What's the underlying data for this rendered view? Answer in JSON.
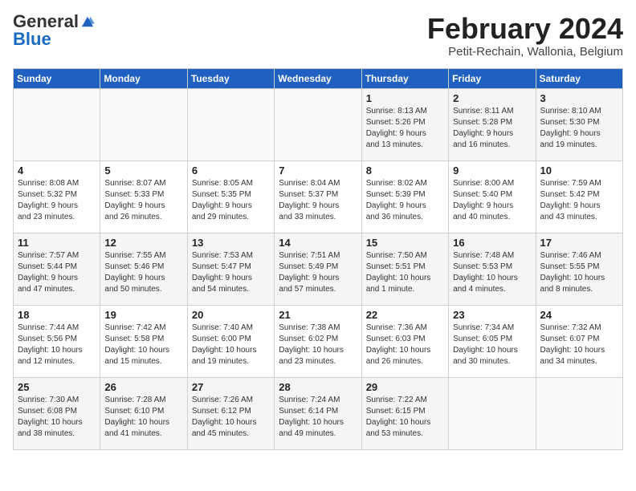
{
  "header": {
    "logo_general": "General",
    "logo_blue": "Blue",
    "month": "February 2024",
    "location": "Petit-Rechain, Wallonia, Belgium"
  },
  "days_of_week": [
    "Sunday",
    "Monday",
    "Tuesday",
    "Wednesday",
    "Thursday",
    "Friday",
    "Saturday"
  ],
  "weeks": [
    [
      {
        "day": "",
        "content": ""
      },
      {
        "day": "",
        "content": ""
      },
      {
        "day": "",
        "content": ""
      },
      {
        "day": "",
        "content": ""
      },
      {
        "day": "1",
        "content": "Sunrise: 8:13 AM\nSunset: 5:26 PM\nDaylight: 9 hours\nand 13 minutes."
      },
      {
        "day": "2",
        "content": "Sunrise: 8:11 AM\nSunset: 5:28 PM\nDaylight: 9 hours\nand 16 minutes."
      },
      {
        "day": "3",
        "content": "Sunrise: 8:10 AM\nSunset: 5:30 PM\nDaylight: 9 hours\nand 19 minutes."
      }
    ],
    [
      {
        "day": "4",
        "content": "Sunrise: 8:08 AM\nSunset: 5:32 PM\nDaylight: 9 hours\nand 23 minutes."
      },
      {
        "day": "5",
        "content": "Sunrise: 8:07 AM\nSunset: 5:33 PM\nDaylight: 9 hours\nand 26 minutes."
      },
      {
        "day": "6",
        "content": "Sunrise: 8:05 AM\nSunset: 5:35 PM\nDaylight: 9 hours\nand 29 minutes."
      },
      {
        "day": "7",
        "content": "Sunrise: 8:04 AM\nSunset: 5:37 PM\nDaylight: 9 hours\nand 33 minutes."
      },
      {
        "day": "8",
        "content": "Sunrise: 8:02 AM\nSunset: 5:39 PM\nDaylight: 9 hours\nand 36 minutes."
      },
      {
        "day": "9",
        "content": "Sunrise: 8:00 AM\nSunset: 5:40 PM\nDaylight: 9 hours\nand 40 minutes."
      },
      {
        "day": "10",
        "content": "Sunrise: 7:59 AM\nSunset: 5:42 PM\nDaylight: 9 hours\nand 43 minutes."
      }
    ],
    [
      {
        "day": "11",
        "content": "Sunrise: 7:57 AM\nSunset: 5:44 PM\nDaylight: 9 hours\nand 47 minutes."
      },
      {
        "day": "12",
        "content": "Sunrise: 7:55 AM\nSunset: 5:46 PM\nDaylight: 9 hours\nand 50 minutes."
      },
      {
        "day": "13",
        "content": "Sunrise: 7:53 AM\nSunset: 5:47 PM\nDaylight: 9 hours\nand 54 minutes."
      },
      {
        "day": "14",
        "content": "Sunrise: 7:51 AM\nSunset: 5:49 PM\nDaylight: 9 hours\nand 57 minutes."
      },
      {
        "day": "15",
        "content": "Sunrise: 7:50 AM\nSunset: 5:51 PM\nDaylight: 10 hours\nand 1 minute."
      },
      {
        "day": "16",
        "content": "Sunrise: 7:48 AM\nSunset: 5:53 PM\nDaylight: 10 hours\nand 4 minutes."
      },
      {
        "day": "17",
        "content": "Sunrise: 7:46 AM\nSunset: 5:55 PM\nDaylight: 10 hours\nand 8 minutes."
      }
    ],
    [
      {
        "day": "18",
        "content": "Sunrise: 7:44 AM\nSunset: 5:56 PM\nDaylight: 10 hours\nand 12 minutes."
      },
      {
        "day": "19",
        "content": "Sunrise: 7:42 AM\nSunset: 5:58 PM\nDaylight: 10 hours\nand 15 minutes."
      },
      {
        "day": "20",
        "content": "Sunrise: 7:40 AM\nSunset: 6:00 PM\nDaylight: 10 hours\nand 19 minutes."
      },
      {
        "day": "21",
        "content": "Sunrise: 7:38 AM\nSunset: 6:02 PM\nDaylight: 10 hours\nand 23 minutes."
      },
      {
        "day": "22",
        "content": "Sunrise: 7:36 AM\nSunset: 6:03 PM\nDaylight: 10 hours\nand 26 minutes."
      },
      {
        "day": "23",
        "content": "Sunrise: 7:34 AM\nSunset: 6:05 PM\nDaylight: 10 hours\nand 30 minutes."
      },
      {
        "day": "24",
        "content": "Sunrise: 7:32 AM\nSunset: 6:07 PM\nDaylight: 10 hours\nand 34 minutes."
      }
    ],
    [
      {
        "day": "25",
        "content": "Sunrise: 7:30 AM\nSunset: 6:08 PM\nDaylight: 10 hours\nand 38 minutes."
      },
      {
        "day": "26",
        "content": "Sunrise: 7:28 AM\nSunset: 6:10 PM\nDaylight: 10 hours\nand 41 minutes."
      },
      {
        "day": "27",
        "content": "Sunrise: 7:26 AM\nSunset: 6:12 PM\nDaylight: 10 hours\nand 45 minutes."
      },
      {
        "day": "28",
        "content": "Sunrise: 7:24 AM\nSunset: 6:14 PM\nDaylight: 10 hours\nand 49 minutes."
      },
      {
        "day": "29",
        "content": "Sunrise: 7:22 AM\nSunset: 6:15 PM\nDaylight: 10 hours\nand 53 minutes."
      },
      {
        "day": "",
        "content": ""
      },
      {
        "day": "",
        "content": ""
      }
    ]
  ]
}
